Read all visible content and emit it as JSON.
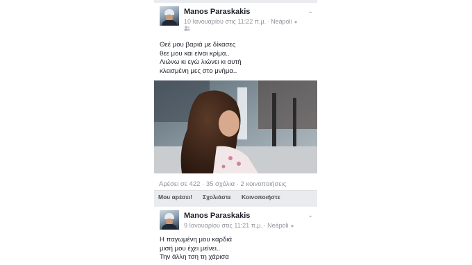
{
  "posts": [
    {
      "author": "Manos Paraskakis",
      "date": "10 Ιανουαρίου στις 11:22 π.μ.",
      "location": "Neápoli",
      "lines": [
        "Θεέ μου βαριά με δίκασες",
        "θεε μου και είναι κρίμα..",
        "Λιώνω κι εγώ λιώνει κι αυτή",
        "κλεισμένη μες στο μνήμα.."
      ],
      "stats": "Αρέσει σε 422 · 35 σχόλια · 2 κοινοποιήσεις"
    },
    {
      "author": "Manos Paraskakis",
      "date": "9 Ιανουαρίου στις 11:21 π.μ.",
      "location": "Neápoli",
      "lines": [
        "Η παγωμένη μου καρδιά",
        "μισή μου έχει μείνει..",
        "Την άλλη τση τη χάρισα"
      ]
    }
  ],
  "actions": {
    "like": "Μου αρέσει!",
    "comment": "Σχολιάστε",
    "share": "Κοινοποιήστε"
  },
  "icons": {
    "chevron": "chevron-down-icon",
    "location": "location-pin-icon",
    "audience": "friends-icon"
  },
  "colors": {
    "feed_bg": "#e9ebee",
    "name": "#1d2129",
    "meta": "#90949c"
  }
}
